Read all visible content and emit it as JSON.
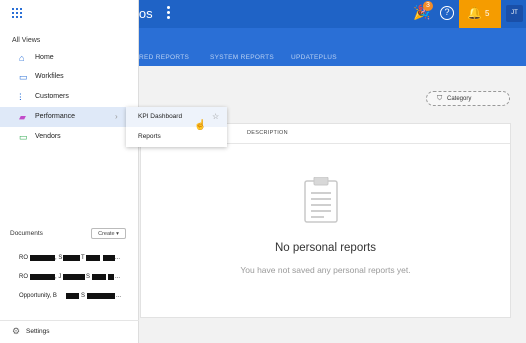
{
  "header": {
    "app_title": "utos",
    "celebrate_badge": "3",
    "notifications_count": "5",
    "avatar_initials": "JT",
    "icons": {
      "apps": "apps-grid-icon",
      "menu": "kebab-icon",
      "celebrate": "party-icon",
      "help": "help-icon",
      "bell": "bell-icon"
    }
  },
  "tabs": [
    {
      "label": "RED REPORTS"
    },
    {
      "label": "SYSTEM REPORTS"
    },
    {
      "label": "UPDATEPLUS"
    }
  ],
  "filter": {
    "category_label": "Category"
  },
  "table": {
    "description_header": "DESCRIPTION"
  },
  "empty_state": {
    "title": "No personal reports",
    "subtitle": "You have not saved any personal reports yet."
  },
  "drawer": {
    "section_title": "All Views",
    "items": [
      {
        "label": "Home",
        "icon": "home-icon"
      },
      {
        "label": "Workfiles",
        "icon": "folder-icon"
      },
      {
        "label": "Customers",
        "icon": "customers-icon"
      },
      {
        "label": "Performance",
        "icon": "performance-icon"
      },
      {
        "label": "Vendors",
        "icon": "vendors-icon"
      }
    ],
    "documents_title": "Documents",
    "create_label": "Create ▾",
    "documents": [
      {
        "text_a": "RO",
        "text_b": ", S",
        "text_c": "T",
        "text_d": "...",
        "text_e": ""
      },
      {
        "text_a": "RO",
        "text_b": ", J",
        "text_c": "S",
        "text_d": "...",
        "text_e": ""
      },
      {
        "text_a": "Opportunity, B",
        "text_b": "S",
        "text_c": "...",
        "text_d": "",
        "text_e": ""
      }
    ],
    "settings_label": "Settings"
  },
  "flyout": {
    "items": [
      {
        "label": "KPI Dashboard"
      },
      {
        "label": "Reports"
      }
    ]
  },
  "colors": {
    "header_blue": "#1f63c6",
    "tab_blue": "#2a6fd6",
    "notification_orange": "#f59c00",
    "active_nav": "#dfe9f8"
  }
}
